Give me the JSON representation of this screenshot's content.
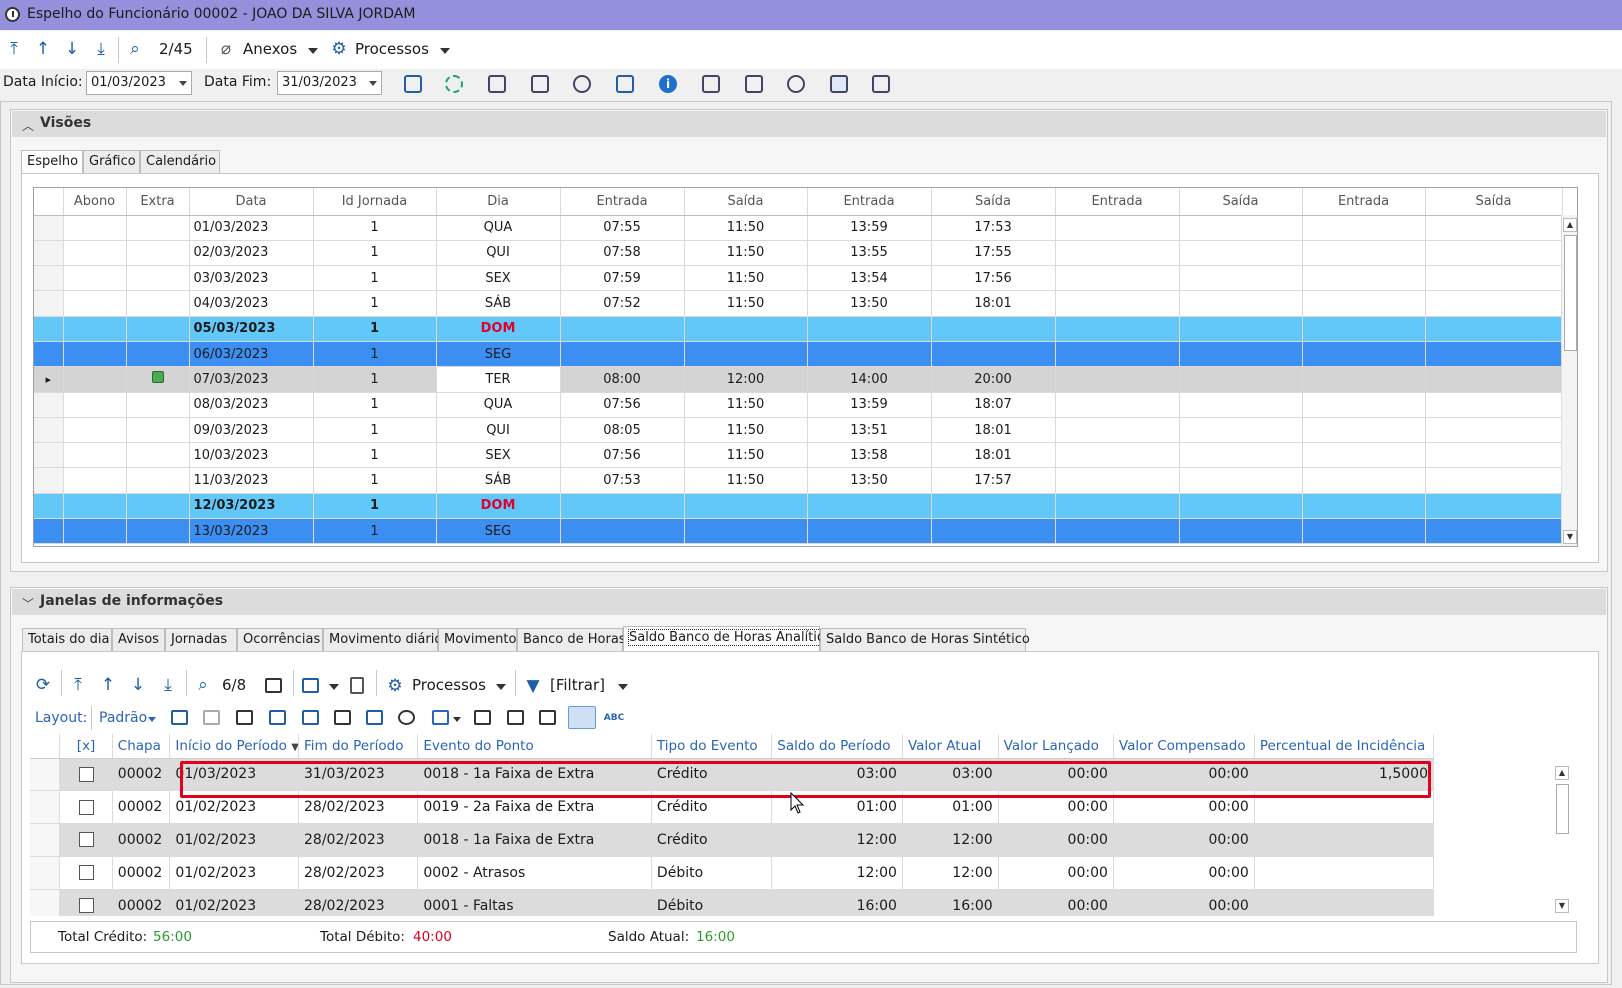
{
  "window": {
    "title": "Espelho do Funcionário 00002 - JOAO DA SILVA JORDAM"
  },
  "toolbar": {
    "record_position": "2/45",
    "anexos_label": "Anexos",
    "processos_label": "Processos"
  },
  "filters": {
    "data_inicio_label": "Data Início:",
    "data_inicio_value": "01/03/2023",
    "data_fim_label": "Data Fim:",
    "data_fim_value": "31/03/2023"
  },
  "visoes": {
    "title": "Visões",
    "tabs": [
      "Espelho",
      "Gráfico",
      "Calendário"
    ],
    "columns": [
      "Abono",
      "Extra",
      "Data",
      "Id Jornada",
      "Dia",
      "Entrada",
      "Saída",
      "Entrada",
      "Saída",
      "Entrada",
      "Saída",
      "Entrada",
      "Saída"
    ],
    "rows": [
      {
        "data": "01/03/2023",
        "id": "1",
        "dia": "QUA",
        "e1": "07:55",
        "s1": "11:50",
        "e2": "13:59",
        "s2": "17:53"
      },
      {
        "data": "02/03/2023",
        "id": "1",
        "dia": "QUI",
        "e1": "07:58",
        "s1": "11:50",
        "e2": "13:55",
        "s2": "17:55"
      },
      {
        "data": "03/03/2023",
        "id": "1",
        "dia": "SEX",
        "e1": "07:59",
        "s1": "11:50",
        "e2": "13:54",
        "s2": "17:56"
      },
      {
        "data": "04/03/2023",
        "id": "1",
        "dia": "SÁB",
        "e1": "07:52",
        "s1": "11:50",
        "e2": "13:50",
        "s2": "18:01"
      },
      {
        "data": "05/03/2023",
        "id": "1",
        "dia": "DOM",
        "e1": "",
        "s1": "",
        "e2": "",
        "s2": ""
      },
      {
        "data": "06/03/2023",
        "id": "1",
        "dia": "SEG",
        "e1": "",
        "s1": "",
        "e2": "",
        "s2": ""
      },
      {
        "data": "07/03/2023",
        "id": "1",
        "dia": "TER",
        "e1": "08:00",
        "s1": "12:00",
        "e2": "14:00",
        "s2": "20:00"
      },
      {
        "data": "08/03/2023",
        "id": "1",
        "dia": "QUA",
        "e1": "07:56",
        "s1": "11:50",
        "e2": "13:59",
        "s2": "18:07"
      },
      {
        "data": "09/03/2023",
        "id": "1",
        "dia": "QUI",
        "e1": "08:05",
        "s1": "11:50",
        "e2": "13:51",
        "s2": "18:01"
      },
      {
        "data": "10/03/2023",
        "id": "1",
        "dia": "SEX",
        "e1": "07:56",
        "s1": "11:50",
        "e2": "13:58",
        "s2": "18:01"
      },
      {
        "data": "11/03/2023",
        "id": "1",
        "dia": "SÁB",
        "e1": "07:53",
        "s1": "11:50",
        "e2": "13:50",
        "s2": "17:57"
      },
      {
        "data": "12/03/2023",
        "id": "1",
        "dia": "DOM",
        "e1": "",
        "s1": "",
        "e2": "",
        "s2": ""
      },
      {
        "data": "13/03/2023",
        "id": "1",
        "dia": "SEG",
        "e1": "",
        "s1": "",
        "e2": "",
        "s2": ""
      }
    ]
  },
  "janelas": {
    "title": "Janelas de informações",
    "tabs": [
      "Totais do dia",
      "Avisos",
      "Jornadas",
      "Ocorrências",
      "Movimento diário",
      "Movimento",
      "Banco de Horas",
      "Saldo Banco de Horas Analítico",
      "Saldo Banco de Horas Sintético"
    ],
    "active_tab": "Saldo Banco de Horas Analítico",
    "toolbar": {
      "record_position": "6/8",
      "processos_label": "Processos",
      "filtrar_label": "[Filtrar]",
      "layout_label": "Layout:",
      "layout_value": "Padrão"
    },
    "columns": [
      "[x]",
      "Chapa",
      "Início do Período",
      "Fim do Período",
      "Evento do Ponto",
      "Tipo do Evento",
      "Saldo do Período",
      "Valor Atual",
      "Valor Lançado",
      "Valor Compensado",
      "Percentual de Incidência"
    ],
    "rows": [
      {
        "chapa": "00002",
        "inicio": "01/03/2023",
        "fim": "31/03/2023",
        "evento": "0018 - 1a Faixa de Extra",
        "tipo": "Crédito",
        "saldo": "03:00",
        "atual": "03:00",
        "lancado": "00:00",
        "compensado": "00:00",
        "percentual": "1,5000"
      },
      {
        "chapa": "00002",
        "inicio": "01/02/2023",
        "fim": "28/02/2023",
        "evento": "0019 - 2a Faixa de Extra",
        "tipo": "Crédito",
        "saldo": "01:00",
        "atual": "01:00",
        "lancado": "00:00",
        "compensado": "00:00",
        "percentual": ""
      },
      {
        "chapa": "00002",
        "inicio": "01/02/2023",
        "fim": "28/02/2023",
        "evento": "0018 - 1a Faixa de Extra",
        "tipo": "Crédito",
        "saldo": "12:00",
        "atual": "12:00",
        "lancado": "00:00",
        "compensado": "00:00",
        "percentual": ""
      },
      {
        "chapa": "00002",
        "inicio": "01/02/2023",
        "fim": "28/02/2023",
        "evento": "0002 - Atrasos",
        "tipo": "Débito",
        "saldo": "12:00",
        "atual": "12:00",
        "lancado": "00:00",
        "compensado": "00:00",
        "percentual": ""
      },
      {
        "chapa": "00002",
        "inicio": "01/02/2023",
        "fim": "28/02/2023",
        "evento": "0001 - Faltas",
        "tipo": "Débito",
        "saldo": "16:00",
        "atual": "16:00",
        "lancado": "00:00",
        "compensado": "00:00",
        "percentual": ""
      }
    ],
    "footer": {
      "total_credito_label": "Total Crédito:",
      "total_credito_value": "56:00",
      "total_debito_label": "Total Débito:",
      "total_debito_value": "40:00",
      "saldo_atual_label": "Saldo Atual:",
      "saldo_atual_value": "16:00"
    }
  },
  "colors": {
    "titlebar": "#9490dc",
    "sunday_row": "#62c8fa",
    "selected_row": "#3b8ff2",
    "credit_green": "#2e9a2e",
    "debit_red": "#e0001b",
    "highlight_box": "#e0001b"
  }
}
